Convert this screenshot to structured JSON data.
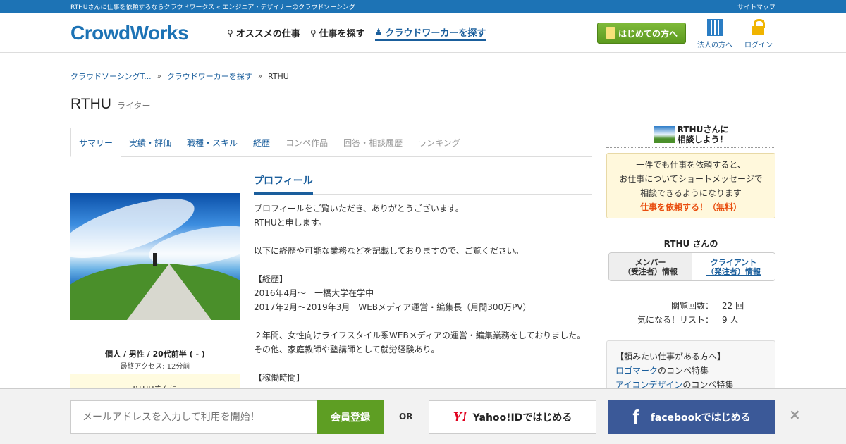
{
  "topbar": {
    "title": "RTHUさんに仕事を依頼するならクラウドワークス « エンジニア・デザイナーのクラウドソーシング",
    "sitemap": "サイトマップ"
  },
  "header": {
    "logo": "CrowdWorks",
    "nav": [
      {
        "label": "オススメの仕事",
        "icon": "lightbulb-icon"
      },
      {
        "label": "仕事を探す",
        "icon": "search-icon"
      },
      {
        "label": "クラウドワーカーを探す",
        "icon": "users-icon"
      }
    ],
    "start_button": "はじめての方へ",
    "corporate": "法人の方へ",
    "login": "ログイン"
  },
  "breadcrumb": {
    "items": [
      "クラウドソーシングT...",
      "クラウドワーカーを探す"
    ],
    "current": "RTHU"
  },
  "profile": {
    "name": "RTHU",
    "role": "ライター"
  },
  "tabs": [
    "サマリー",
    "実績・評価",
    "職種・スキル",
    "経歴",
    "コンペ作品",
    "回答・相談履歴",
    "ランキング"
  ],
  "left": {
    "info": "個人 / 男性 / 20代前半 ( - )",
    "last_access": "最終アクセス: 12分前",
    "consult": "RTHUさんに"
  },
  "profile_section": {
    "title": "プロフィール",
    "lines": [
      "プロフィールをご覧いただき、ありがとうございます。",
      "RTHUと申します。",
      "",
      "以下に経歴や可能な業務などを記載しておりますので、ご覧ください。",
      "",
      "【経歴】",
      "2016年4月〜　一橋大学在学中",
      "2017年2月〜2019年3月　WEBメディア運営・編集長（月間300万PV）",
      "",
      "２年間、女性向けライフスタイル系WEBメディアの運営・編集業務をしておりました。",
      "その他、家庭教師や塾講師として就労経験あり。",
      "",
      "【稼働時間】"
    ]
  },
  "right": {
    "consult_title_1": "RTHUさんに",
    "consult_title_2": "相談しよう！",
    "box_line1": "一件でも仕事を依頼すると、",
    "box_line2": "お仕事についてショートメッセージで",
    "box_line3": "相談できるようになります",
    "box_cta": "仕事を依頼する！（無料）",
    "sub": "RTHU さんの",
    "tab_member": "メンバー\n（受注者）情報",
    "tab_member_1": "メンバー",
    "tab_member_2": "（受注者）情報",
    "tab_client_1": "クライアント",
    "tab_client_2": "（発注者）情報",
    "views_label": "閲覧回数：",
    "views_value": "22 回",
    "fav_label": "気になる！リスト：",
    "fav_value": "9 人",
    "box2_title": "【頼みたい仕事がある方へ】",
    "box2_link1": "ロゴマーク",
    "box2_text1": "のコンペ特集",
    "box2_link2": "アイコンデザイン",
    "box2_text2": "のコンペ特集"
  },
  "bottom": {
    "email_placeholder": "メールアドレスを入力して利用を開始！",
    "register": "会員登録",
    "or": "OR",
    "yahoo": "Yahoo!IDではじめる",
    "yahoo_mark": "Y!",
    "facebook": "facebookではじめる",
    "fb_mark": "f",
    "close": "×"
  }
}
